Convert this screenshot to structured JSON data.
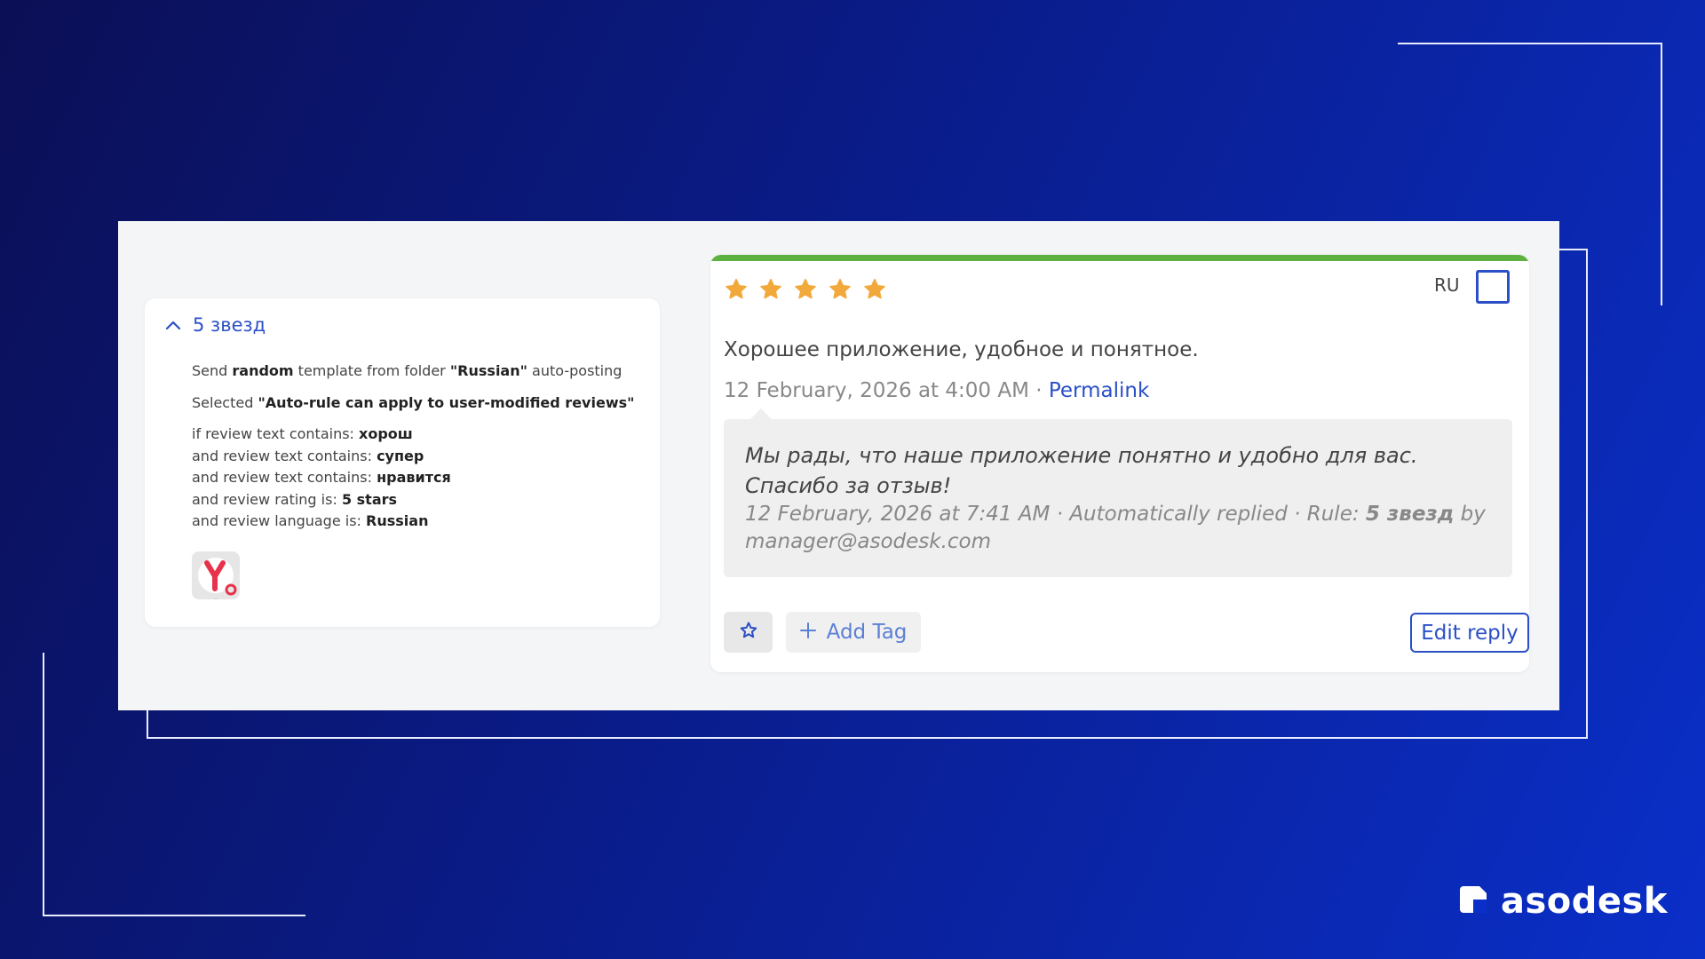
{
  "rule": {
    "title": "5 звезд",
    "send": {
      "prefix": "Send ",
      "mode": "random",
      "mid": " template from folder ",
      "folder": "\"Russian\"",
      "suffix": " auto-posting"
    },
    "selected": {
      "prefix": "Selected ",
      "option": "\"Auto-rule can apply to user-modified reviews\""
    },
    "conditions": [
      {
        "label": "if review text contains: ",
        "value": "хорош"
      },
      {
        "label": "and review text contains: ",
        "value": "супер"
      },
      {
        "label": "and review text contains: ",
        "value": "нравится"
      },
      {
        "label": "and review rating is: ",
        "value": "5 stars"
      },
      {
        "label": "and review language is: ",
        "value": "Russian"
      }
    ]
  },
  "review": {
    "rating": 5,
    "language": "RU",
    "text": "Хорошее приложение, удобное и понятное.",
    "date": "12 February, 2026 at 4:00 AM",
    "separator": " · ",
    "permalink": "Permalink",
    "reply": {
      "text": "Мы рады, что наше приложение понятно и удобно для вас. Спасибо за отзыв!",
      "meta_prefix": "12 February, 2026 at 7:41 AM · Automatically replied · Rule: ",
      "rule_name": "5 звезд",
      "meta_suffix": " by manager@asodesk.com"
    },
    "add_tag": "Add Tag",
    "edit_reply": "Edit reply"
  },
  "brand": {
    "name": "asodesk"
  },
  "colors": {
    "accent": "#2a4fc7",
    "star": "#f2a93b",
    "rating_bar": "#5cb141"
  },
  "icons": {
    "collapse": "chevron-up-icon",
    "favorite": "star-outline-icon",
    "add": "plus-icon",
    "app": "yandex-app-icon",
    "logo": "asodesk-logo-icon"
  }
}
